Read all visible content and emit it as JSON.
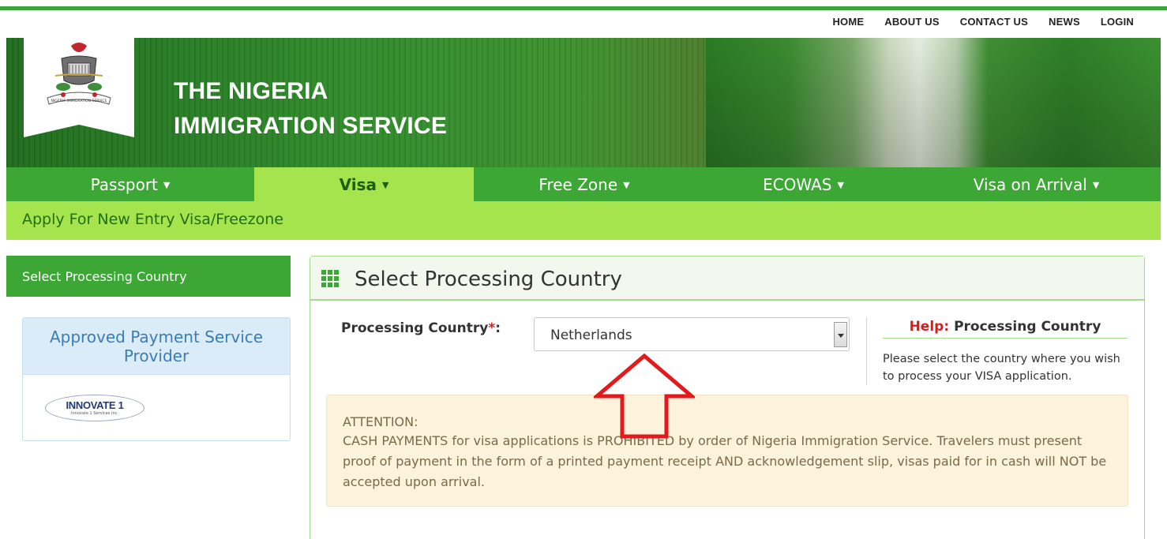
{
  "top_nav": [
    "HOME",
    "ABOUT US",
    "CONTACT US",
    "NEWS",
    "LOGIN"
  ],
  "site": {
    "title_line1": "THE NIGERIA",
    "title_line2": "IMMIGRATION SERVICE",
    "logo_text": "NIGERIA IMMIGRATION SERVICE"
  },
  "main_nav": [
    {
      "label": "Passport",
      "active": false
    },
    {
      "label": "Visa",
      "active": true
    },
    {
      "label": "Free Zone",
      "active": false
    },
    {
      "label": "ECOWAS",
      "active": false
    },
    {
      "label": "Visa on Arrival",
      "active": false
    }
  ],
  "subbar": {
    "label": "Apply For New Entry Visa/Freezone"
  },
  "sidebar": {
    "heading": "Select Processing Country",
    "psp_title": "Approved Payment Service Provider",
    "psp_logo_name": "INNOVATE 1",
    "psp_logo_subtext": "Innovate 1 Services Inc."
  },
  "panel": {
    "title": "Select Processing Country",
    "field_label": "Processing Country",
    "required_mark": "*",
    "field_colon": ":",
    "selected_country": "Netherlands"
  },
  "help": {
    "prefix": "Help:",
    "title": "Processing Country",
    "text": "Please select the country where you wish to process your VISA application."
  },
  "attention": {
    "title": "ATTENTION:",
    "body": "CASH PAYMENTS for visa applications is PROHIBITED by order of Nigeria Immigration Service. Travelers must present proof of payment in the form of a printed payment receipt AND acknowledgement slip, visas paid for in cash will NOT be accepted upon arrival."
  },
  "colors": {
    "nav_green": "#3ca735",
    "active_lime": "#a6e44d",
    "required_red": "#e01a1a",
    "annotation_arrow": "#e3191c"
  }
}
